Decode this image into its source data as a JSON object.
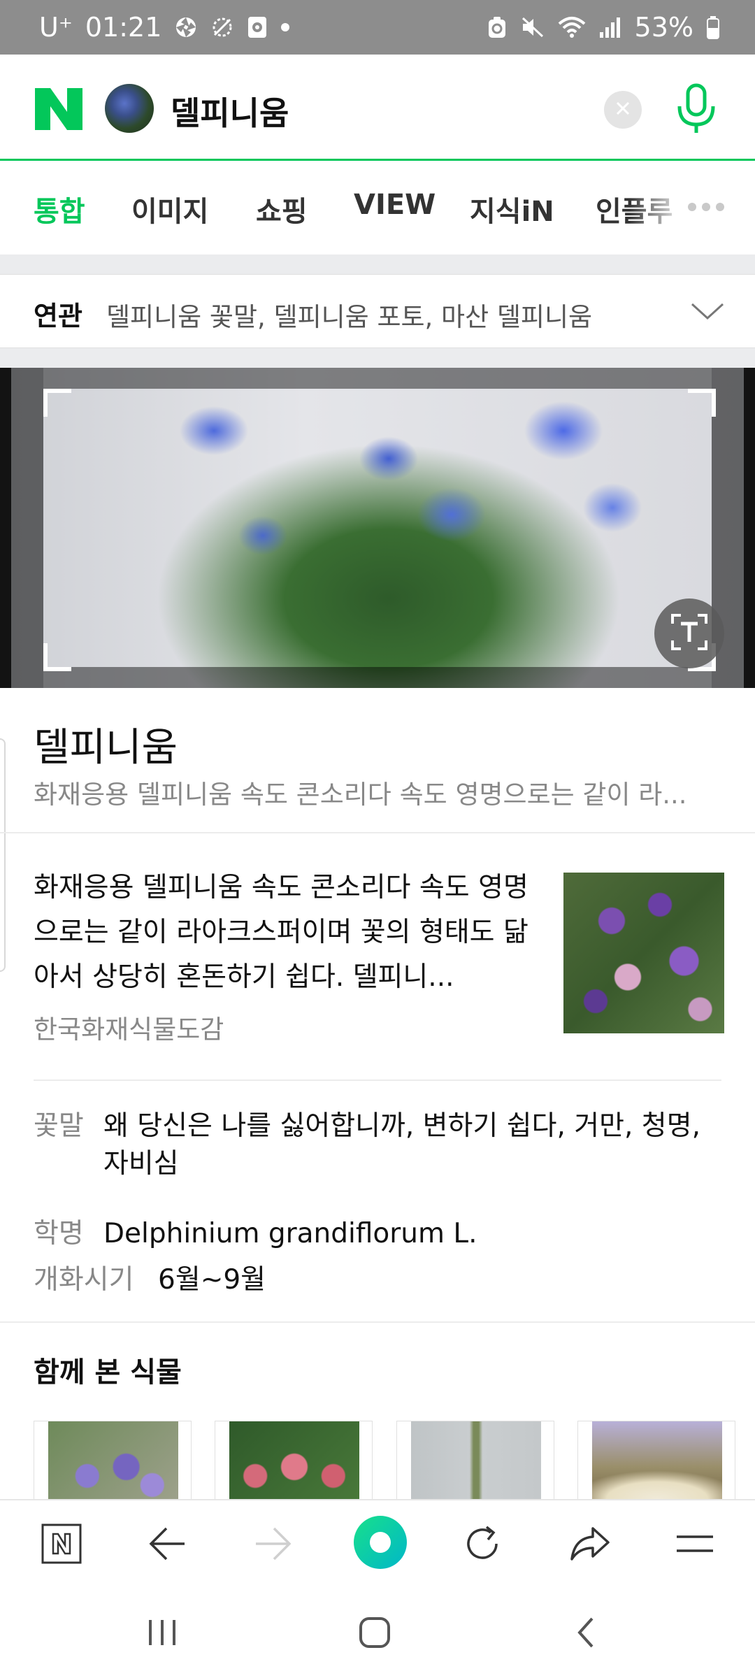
{
  "status_bar": {
    "carrier": "U⁺",
    "time": "01:21",
    "battery": "53%"
  },
  "search": {
    "logo": "N",
    "query": "델피니움"
  },
  "tabs": [
    {
      "label": "통합",
      "active": true
    },
    {
      "label": "이미지"
    },
    {
      "label": "쇼핑"
    },
    {
      "label": "VIEW"
    },
    {
      "label": "지식iN"
    },
    {
      "label": "인플루"
    }
  ],
  "related": {
    "label": "연관",
    "text": "델피니움 꽃말, 델피니움 포토, 마산 델피니움"
  },
  "knowledge": {
    "title": "델피니움",
    "subtitle": "화재응용 델피니움 속도 콘소리다 속도 영명으로는 같이 라...",
    "description": "화재응용 델피니움 속도 콘소리다 속도 영명으로는 같이 라아크스퍼이며 꽃의 형태도 닮아서 상당히 혼돈하기 쉽다. 델피니...",
    "source": "한국화재식물도감",
    "info": [
      {
        "key": "꽃말",
        "value": "왜 당신은 나를 싫어합니까, 변하기 쉽다, 거만, 청명, 자비심"
      },
      {
        "key": "학명",
        "value": "Delphinium grandiflorum L."
      },
      {
        "key": "개화시기",
        "value": "6월~9월"
      }
    ],
    "related_plants_title": "함께 본 식물"
  },
  "colors": {
    "accent": "#03c75a",
    "status_bar": "#8d8d8d"
  },
  "icons": {
    "clear": "close-icon",
    "mic": "microphone-icon",
    "text_scan": "text-scan-icon",
    "chevron": "chevron-down-icon"
  }
}
